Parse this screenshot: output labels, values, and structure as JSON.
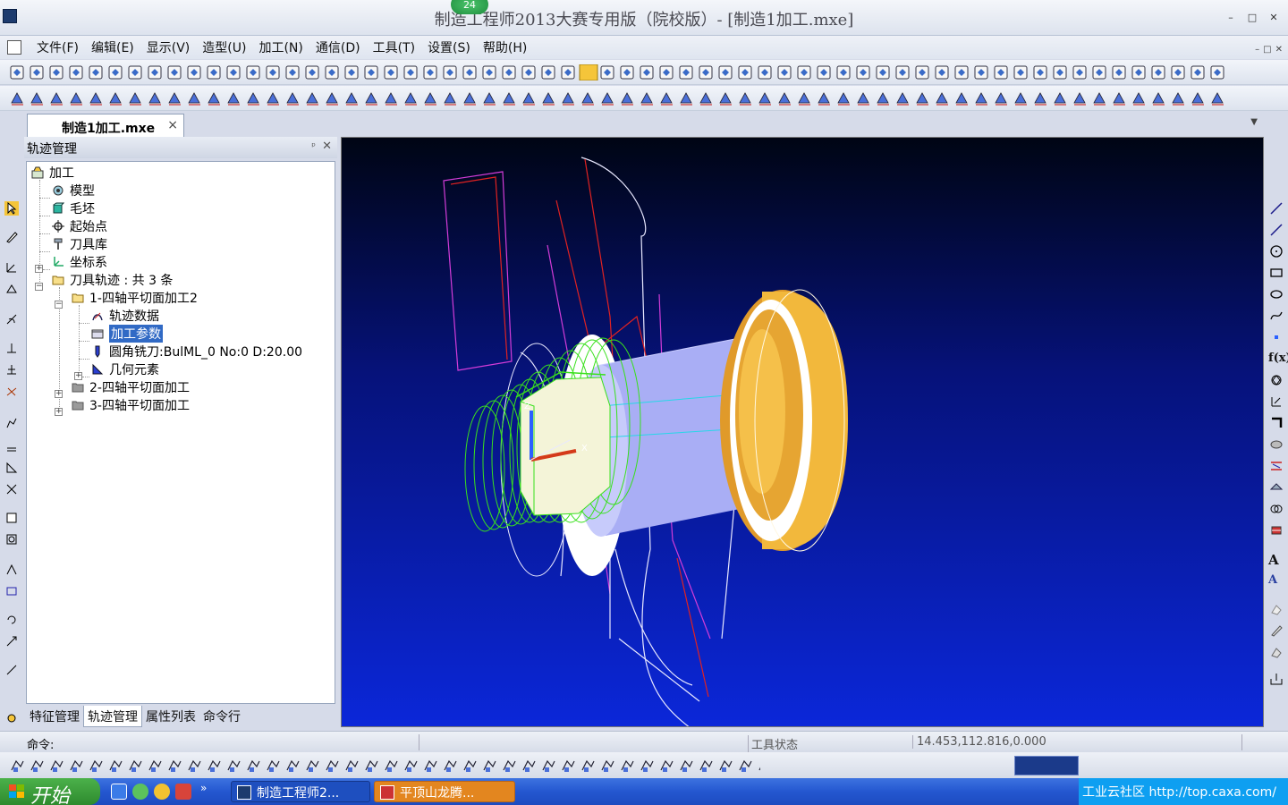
{
  "window": {
    "title": "制造工程师2013大赛专用版（院校版）- [制造1加工.mxe]",
    "notification_badge": "24",
    "controls": [
      "–",
      "□",
      "✕"
    ]
  },
  "menu": {
    "items": [
      "文件(F)",
      "编辑(E)",
      "显示(V)",
      "造型(U)",
      "加工(N)",
      "通信(D)",
      "工具(T)",
      "设置(S)",
      "帮助(H)"
    ],
    "mdi_controls": [
      "–",
      "□",
      "✕"
    ]
  },
  "doc_tab": {
    "label": "制造1加工.mxe",
    "close": "×",
    "dropdown": "▼"
  },
  "panel": {
    "title": "轨迹管理",
    "pin": "ᵖ",
    "close": "✕",
    "tree": [
      {
        "label": "加工",
        "icon": "machining-root-icon"
      },
      {
        "label": "模型",
        "icon": "model-icon"
      },
      {
        "label": "毛坯",
        "icon": "blank-icon"
      },
      {
        "label": "起始点",
        "icon": "start-point-icon"
      },
      {
        "label": "刀具库",
        "icon": "tool-library-icon"
      },
      {
        "label": "坐标系",
        "icon": "coordinate-system-icon"
      },
      {
        "label": "刀具轨迹 : 共 3 条",
        "icon": "folder-open-icon"
      },
      {
        "label": "1-四轴平切面加工2",
        "icon": "folder-open-icon"
      },
      {
        "label": "轨迹数据",
        "icon": "trajectory-data-icon"
      },
      {
        "label": "加工参数",
        "icon": "parameters-icon",
        "selected": true
      },
      {
        "label": "圆角铣刀:BulML_0 No:0 D:20.00",
        "icon": "bull-nose-cutter-icon"
      },
      {
        "label": "几何元素",
        "icon": "geometry-icon"
      },
      {
        "label": "2-四轴平切面加工",
        "icon": "folder-closed-icon"
      },
      {
        "label": "3-四轴平切面加工",
        "icon": "folder-closed-icon"
      }
    ],
    "tabs": [
      "特征管理",
      "轨迹管理",
      "属性列表",
      "命令行"
    ],
    "active_tab": "轨迹管理"
  },
  "status": {
    "command_label": "命令:",
    "tool_state": "工具状态",
    "coordinates": "14.453,112.816,0.000"
  },
  "taskbar": {
    "start_label": "开始",
    "quick_more": "»",
    "tasks": [
      "制造工程师2...",
      "平顶山龙腾..."
    ],
    "tray_text": "工业云社区 http://top.caxa.com/"
  },
  "right_strip_text": {
    "fx": "f(x)",
    "text_a": "A",
    "text_a2": "A"
  },
  "colors": {
    "viewport_top": "#000514",
    "viewport_bottom": "#0b27d9",
    "part_gold": "#f2b83c",
    "part_body": "#a9aef5",
    "toolpath_green": "#39e01c",
    "selected": "#316ac5",
    "taskbar_blue": "#2457d0",
    "start_green": "#3a9e3a"
  }
}
